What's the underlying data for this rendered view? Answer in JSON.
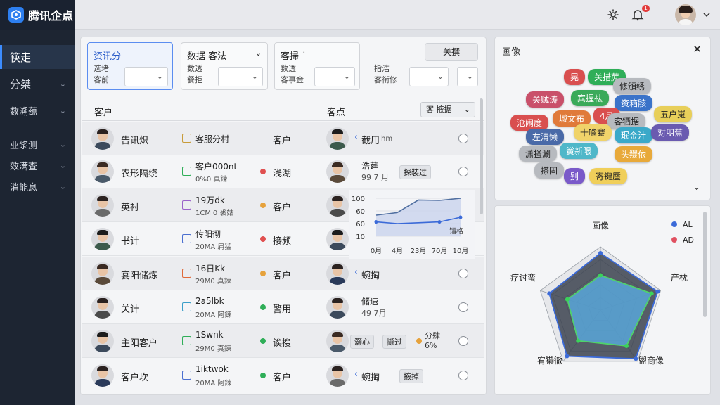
{
  "app": {
    "name": "腾讯企点"
  },
  "topbar": {
    "notif_count": "1"
  },
  "sidebar": {
    "items": [
      {
        "label": "筷走",
        "chev": false
      },
      {
        "label": "分桀",
        "chev": true
      },
      {
        "label": "数溯蕴",
        "chev": true
      },
      {
        "label": "业浆测",
        "chev": true
      },
      {
        "label": "效满查",
        "chev": true
      },
      {
        "label": "消能息",
        "chev": true
      }
    ]
  },
  "filters": {
    "f1": {
      "title": "资讯分",
      "sub1": "选堵",
      "sub2": "客前"
    },
    "f2": {
      "title": "数据 客法",
      "sub1": "数透",
      "sub2": "餐拒"
    },
    "f3": {
      "title": "客掃 ˙",
      "sub1": "数透",
      "sub2": "客事金"
    },
    "f4": {
      "title": "关撰",
      "sub1": "指浩",
      "sub2": "客衔修"
    }
  },
  "table": {
    "header_left": "客户",
    "header_mid": "客点",
    "header_btn": "客 掖据",
    "rows": [
      {
        "name": "告讯炽",
        "tag_label": "客服分村",
        "tag_sub": "",
        "tag_color": "#c89c3a",
        "status": "客户",
        "status_color": "",
        "right_text": "截用",
        "right_sub": "hm",
        "right_kind": "link"
      },
      {
        "name": "农形隔绕",
        "tag_label": "客户000nt",
        "tag_sub": "0%0 真鍊",
        "tag_color": "#2fae58",
        "status": "浅湖",
        "status_color": "#e05050",
        "right_text": "浩莛",
        "right_sub": "99 7 月 ",
        "right_kind": "chip",
        "chip": "探裝过"
      },
      {
        "name": "英衬",
        "tag_label": "19万dk",
        "tag_sub": "1CMI0 裘姑",
        "tag_color": "#9a62c9",
        "status": "客户",
        "status_color": "#e6a23c",
        "right_text": "",
        "right_sub": "",
        "right_kind": "chart"
      },
      {
        "name": "书计",
        "tag_label": "传阳彻",
        "tag_sub": "20MA 肩猛",
        "tag_color": "#4a6fd0",
        "status": "接频",
        "status_color": "#e05050",
        "right_text": "",
        "right_sub": "",
        "right_kind": "chart"
      },
      {
        "name": "宴阳储炼",
        "tag_label": "16日Kk",
        "tag_sub": "29M0 真鍊",
        "tag_color": "#e06a3a",
        "status": "客户",
        "status_color": "#e6a23c",
        "right_text": "蜿掏",
        "right_sub": "",
        "right_kind": "link"
      },
      {
        "name": "关计",
        "tag_label": "2a5lbk",
        "tag_sub": "20MA 阿鍊",
        "tag_color": "#3b9fc9",
        "status": "警用",
        "status_color": "#2fae58",
        "right_text": "储速",
        "right_sub": "49 7月",
        "right_kind": "plain"
      },
      {
        "name": "主阳客户",
        "tag_label": "1Swnk",
        "tag_sub": "29M0 真鍊",
        "tag_color": "#2fae58",
        "status": "诶搜",
        "status_color": "#2fae58",
        "right_text": "",
        "right_sub": "",
        "right_kind": "chips",
        "chips": [
          "灏心",
          "撷过"
        ],
        "extra": "分肆",
        "extra2": "6%"
      },
      {
        "name": "客户坎",
        "tag_label": "1iktwok",
        "tag_sub": "20MA 阿鍊",
        "tag_color": "#4a6fd0",
        "status": "客户",
        "status_color": "#2fae58",
        "right_text": "蜿掏",
        "right_sub": "",
        "right_kind": "linkchip",
        "chip": "掖掉"
      }
    ]
  },
  "mini_chart": {
    "type": "line",
    "y_ticks": [
      "100",
      "60",
      "60",
      "10"
    ],
    "x_ticks": [
      "0月",
      "4月",
      "23月",
      "70月",
      "10月"
    ],
    "series": [
      {
        "name": "",
        "color": "#4f6ea0",
        "values": [
          60,
          66,
          96,
          95,
          100
        ]
      },
      {
        "name": "",
        "color": "#3b6ad8",
        "values": [
          44,
          40,
          42,
          44,
          55
        ]
      }
    ],
    "label": "镭格"
  },
  "persona": {
    "title": "画像",
    "tags": [
      {
        "text": "晃",
        "color": "#d94f4f"
      },
      {
        "text": "关措蔗",
        "color": "#2fae58"
      },
      {
        "text": "修頒绣",
        "color": "#b7babf"
      },
      {
        "text": "关贼涛",
        "color": "#c9506a"
      },
      {
        "text": "宾握祛",
        "color": "#3aaa5a"
      },
      {
        "text": "资箱骸",
        "color": "#3a73c9"
      },
      {
        "text": "4月",
        "color": "#d94f4f"
      },
      {
        "text": "沧闹度",
        "color": "#d94f4f"
      },
      {
        "text": "城文布",
        "color": "#e07a3a"
      },
      {
        "text": "客牺据",
        "color": "#b7babf"
      },
      {
        "text": "五户嵬",
        "color": "#e8cf5a"
      },
      {
        "text": "十嚙蹇",
        "color": "#f0d36a"
      },
      {
        "text": "左清懒",
        "color": "#4a6aa8"
      },
      {
        "text": "珉金汁",
        "color": "#3ba9c9"
      },
      {
        "text": "对朋蕉",
        "color": "#6a5ab0"
      },
      {
        "text": "潇搔涮",
        "color": "#b7babf"
      },
      {
        "text": "黉新限",
        "color": "#4fb7c9"
      },
      {
        "text": "头羰依",
        "color": "#e8a93a"
      },
      {
        "text": "搽固",
        "color": "#b7babf"
      },
      {
        "text": "别",
        "color": "#7a5ac9"
      },
      {
        "text": "寄键蜃",
        "color": "#f0cf5a"
      }
    ]
  },
  "radar": {
    "axes": [
      "画像",
      "产枕",
      "盥商像",
      "宥獭徹",
      "疗讨蛮"
    ],
    "series": [
      {
        "name": "AL",
        "color": "#3b6ad8",
        "values": [
          0.9,
          0.95,
          0.95,
          0.9,
          0.85
        ]
      },
      {
        "name": "AD",
        "color": "#e05060",
        "values": [
          0.55,
          0.85,
          0.7,
          0.6,
          0.55
        ]
      }
    ]
  }
}
